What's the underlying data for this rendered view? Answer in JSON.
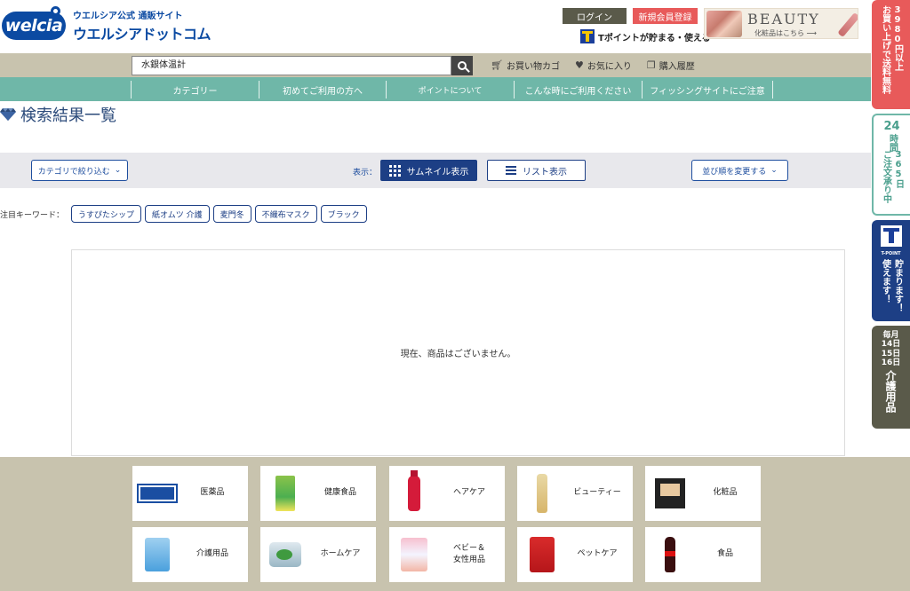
{
  "header": {
    "logo_brand": "welcia",
    "logo_tagline": "ウエルシア公式 通販サイト",
    "logo_name": "ウエルシアドットコム",
    "login_label": "ログイン",
    "register_label": "新規会員登録",
    "tpoint_text": "Tポイントが貯まる・使える",
    "beauty_banner": {
      "title": "BEAUTY",
      "subtitle": "化粧品はこちら ⟶"
    }
  },
  "search": {
    "value": "水銀体温計",
    "quick_links": [
      {
        "label": "お買い物カゴ",
        "icon": "cart-icon"
      },
      {
        "label": "お気に入り",
        "icon": "heart-icon"
      },
      {
        "label": "購入履歴",
        "icon": "history-icon"
      }
    ]
  },
  "nav": {
    "items": [
      "カテゴリー",
      "初めてご利用の方へ",
      "ポイントについて",
      "こんな時にご利用ください",
      "フィッシングサイトにご注意"
    ]
  },
  "page_title": "検索結果一覧",
  "filter": {
    "category_select": "カテゴリで絞り込む",
    "view_label": "表示：",
    "thumbnail_view": "サムネイル表示",
    "list_view": "リスト表示",
    "sort_select": "並び順を変更する"
  },
  "keywords": {
    "label": "注目キーワード：",
    "tags": [
      "うすぴたシップ",
      "紙オムツ 介護",
      "麦門冬",
      "不織布マスク",
      "ブラック"
    ]
  },
  "results": {
    "empty_message": "現在、商品はございません。"
  },
  "categories": [
    {
      "label": "医薬品",
      "thumb": "bufferin"
    },
    {
      "label": "健康食品",
      "thumb": "box-green"
    },
    {
      "label": "ヘアケア",
      "thumb": "bottle-red"
    },
    {
      "label": "ビューティー",
      "thumb": "bottle-gold"
    },
    {
      "label": "化粧品",
      "thumb": "compact"
    },
    {
      "label": "介護用品",
      "thumb": "diaper"
    },
    {
      "label": "ホームケア",
      "thumb": "detergent"
    },
    {
      "label": "ベビー＆\n女性用品",
      "thumb": "baby"
    },
    {
      "label": "ペットケア",
      "thumb": "petfood"
    },
    {
      "label": "食品",
      "thumb": "cola"
    }
  ],
  "side_tabs": {
    "shipping": {
      "col1": "お買い上げで送料無料",
      "col2": "3980円以上"
    },
    "hours": {
      "top": "24",
      "col1": "時間",
      "col2": "ご注文承り中",
      "col3": "365日"
    },
    "tpoint": {
      "caption": "T-POINT",
      "col1": "貯まります！",
      "col2": "使えます！"
    },
    "kaigo": {
      "days": [
        "毎月",
        "14日",
        "15日",
        "16日"
      ],
      "main": "介護用品"
    }
  },
  "colors": {
    "brand_blue": "#0b4aa2",
    "nav_green": "#6fb7a8",
    "khaki": "#c8c3ae",
    "accent_red": "#e85a5a",
    "navy": "#1d3f85"
  }
}
